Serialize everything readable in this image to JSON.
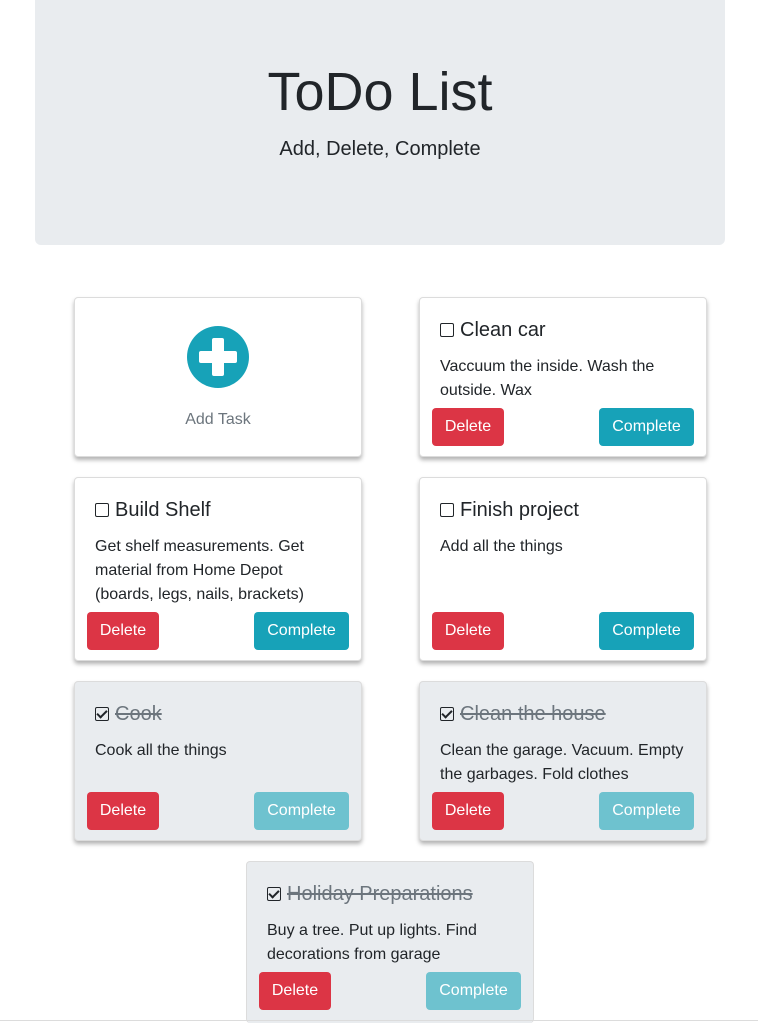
{
  "header": {
    "title": "ToDo List",
    "subtitle": "Add, Delete, Complete"
  },
  "add_task": {
    "label": "Add Task",
    "icon": "plus-circle-icon"
  },
  "tasks": [
    {
      "title": "Clean car",
      "description": "Vaccuum the inside. Wash the outside. Wax",
      "completed": false,
      "delete_label": "Delete",
      "complete_label": "Complete"
    },
    {
      "title": "Build Shelf",
      "description": "Get shelf measurements. Get material from Home Depot (boards, legs, nails, brackets)",
      "completed": false,
      "delete_label": "Delete",
      "complete_label": "Complete"
    },
    {
      "title": "Finish project",
      "description": "Add all the things",
      "completed": false,
      "delete_label": "Delete",
      "complete_label": "Complete"
    },
    {
      "title": "Cook",
      "description": "Cook all the things",
      "completed": true,
      "delete_label": "Delete",
      "complete_label": "Complete"
    },
    {
      "title": "Clean the house",
      "description": "Clean the garage. Vacuum. Empty the garbages. Fold clothes",
      "completed": true,
      "delete_label": "Delete",
      "complete_label": "Complete"
    },
    {
      "title": "Holiday Preparations",
      "description": "Buy a tree. Put up lights. Find decorations from garage",
      "completed": true,
      "delete_label": "Delete",
      "complete_label": "Complete"
    }
  ],
  "colors": {
    "jumbotron_bg": "#e9ecef",
    "delete": "#dc3545",
    "complete": "#17a2b8",
    "complete_disabled": "#6ec2cf"
  }
}
